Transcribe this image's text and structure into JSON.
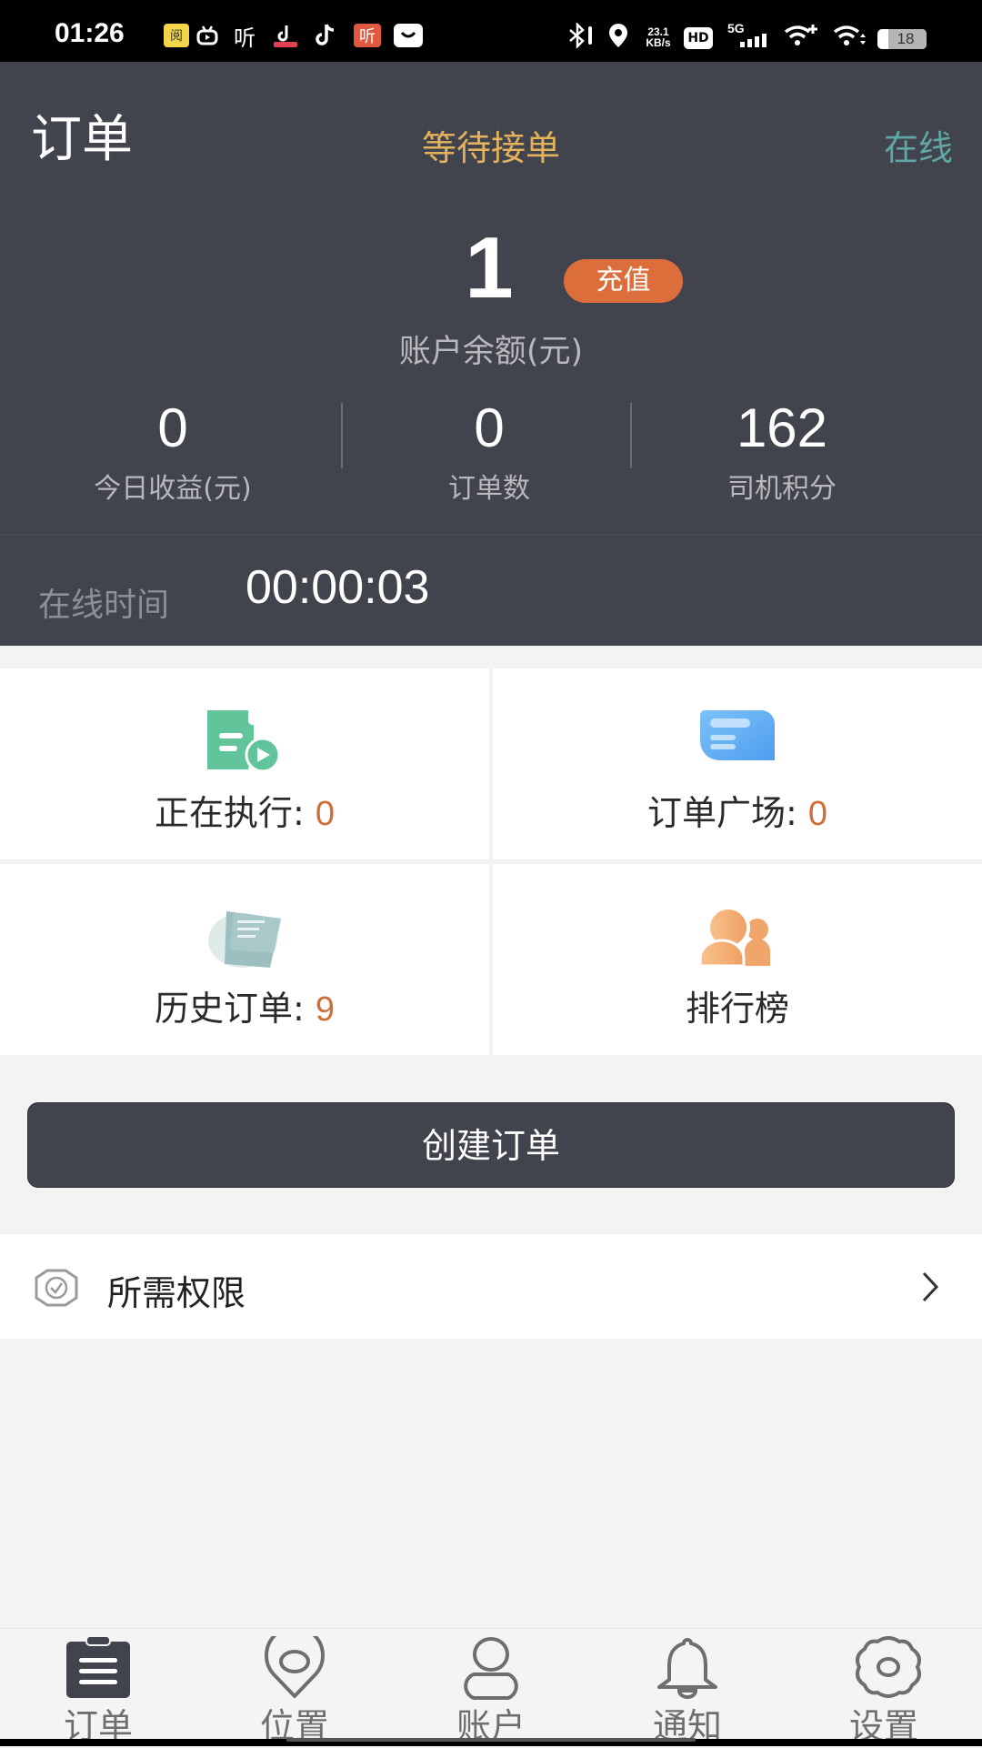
{
  "status_bar": {
    "time": "01:26",
    "network_speed_value": "23.1",
    "network_speed_unit": "KB/s",
    "hd_label": "HD",
    "signal_label": "5G",
    "battery": "18",
    "notification_icons": [
      "reading-app-icon",
      "bilibili-icon",
      "listen-app-icon",
      "douyin-lite-icon",
      "douyin-icon",
      "listen-app-red-icon",
      "message-icon"
    ],
    "system_icons": [
      "bluetooth-icon",
      "location-icon",
      "hd-icon",
      "signal-icon",
      "wifi-plus-icon",
      "wifi-icon",
      "battery-icon"
    ]
  },
  "header": {
    "title": "订单",
    "status": "等待接单",
    "online_status": "在线",
    "colors": {
      "background": "#41434d",
      "status": "#e4b25d",
      "online": "#5fa7a4",
      "recharge": "#dc6e3b"
    }
  },
  "balance": {
    "value": "1",
    "label": "账户余额(元)",
    "recharge_label": "充值"
  },
  "stats": [
    {
      "value": "0",
      "label": "今日收益(元)"
    },
    {
      "value": "0",
      "label": "订单数"
    },
    {
      "value": "162",
      "label": "司机积分"
    }
  ],
  "online_time": {
    "label": "在线时间",
    "value": "00:00:03"
  },
  "cards": [
    {
      "label": "正在执行:",
      "count": "0",
      "icon": "executing-order-icon"
    },
    {
      "label": "订单广场:",
      "count": "0",
      "icon": "order-square-icon"
    },
    {
      "label": "历史订单:",
      "count": "9",
      "icon": "history-order-icon"
    },
    {
      "label": "排行榜",
      "count": "",
      "icon": "leaderboard-icon"
    }
  ],
  "create_order_label": "创建订单",
  "permissions": {
    "label": "所需权限"
  },
  "tabbar": [
    {
      "label": "订单",
      "icon": "clipboard-icon",
      "active": true
    },
    {
      "label": "位置",
      "icon": "location-pin-icon",
      "active": false
    },
    {
      "label": "账户",
      "icon": "user-icon",
      "active": false
    },
    {
      "label": "通知",
      "icon": "bell-icon",
      "active": false
    },
    {
      "label": "设置",
      "icon": "gear-icon",
      "active": false
    }
  ]
}
